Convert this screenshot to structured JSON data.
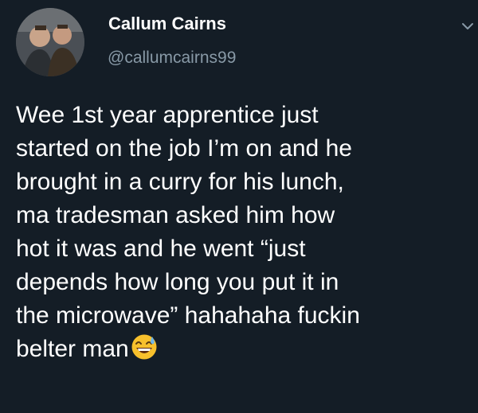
{
  "author": {
    "display_name": "Callum Cairns",
    "handle": "@callumcairns99"
  },
  "tweet": {
    "lines": [
      "Wee 1st year apprentice just",
      "started on the job I’m on and he",
      "brought in a curry for his lunch,",
      "ma tradesman asked him how",
      "hot it was and he went “just",
      "depends how long you put it in",
      "the microwave” hahahaha fuckin",
      "belter man"
    ],
    "trailing_emoji": "grinning-sweat-emoji"
  },
  "icons": {
    "menu": "chevron-down-icon"
  },
  "colors": {
    "background": "#141d26",
    "text": "#ffffff",
    "secondary_text": "#8899a6",
    "emoji_yellow": "#f7c02c"
  }
}
